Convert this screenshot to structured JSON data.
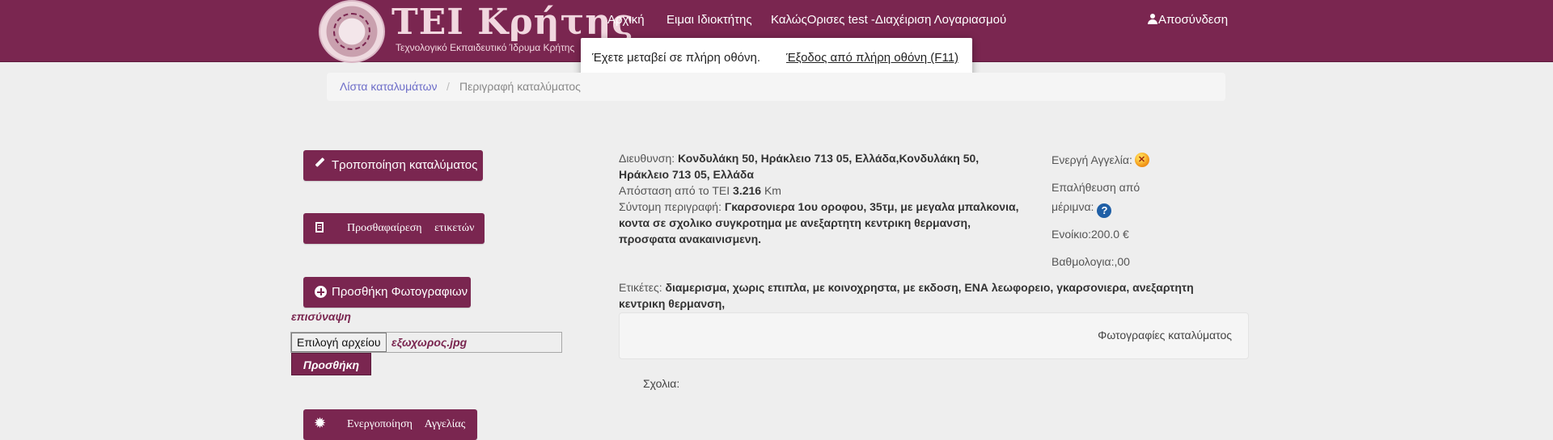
{
  "header": {
    "logo_title": "ΤΕΙ Κρήτης",
    "logo_subtitle": "Τεχνολογικό Εκπαιδευτικό Ίδρυμα Κρήτης",
    "nav": {
      "home": "Αρχική",
      "owner": "Ειμαι Ιδιοκτήτης",
      "account": "ΚαλώςΟρισες test -Διαχέιριση Λογαριασμού",
      "logout": "Αποσύνδεση"
    },
    "brand_color": "#7a2650"
  },
  "fullscreen_toast": {
    "message": "Έχετε μεταβεί σε πλήρη οθόνη.",
    "exit_link": "Έξοδος από πλήρη οθόνη (F11)"
  },
  "breadcrumb": {
    "list": "Λίστα καταλυμάτων",
    "separator": "/",
    "current": "Περιγραφή καταλύματος"
  },
  "actions": {
    "edit": "Τροποποίηση καταλύματος",
    "tags": "Προσθαφαίρεση ετικετών",
    "add_photos": "Προσθήκη Φωτογραφιων",
    "attach_label": "επισύναψη",
    "choose_file": "Επιλογή αρχείου",
    "file_name": "εξωχωρος.jpg",
    "add_button": "Προσθήκη",
    "activate": "Ενεργοποίηση Αγγελίας"
  },
  "listing": {
    "address_label": "Διευθυνση:",
    "address_line1": "Κονδυλάκη 50, Ηράκλειο 713 05, Ελλάδα,Κονδυλάκη 50,",
    "address_line2": "Ηράκλειο 713 05, Ελλάδα",
    "distance_label": "Απόσταση από το ΤΕΙ",
    "distance_value": "3.216",
    "distance_unit": "Km",
    "desc_label": "Σύντομη περιγραφή:",
    "desc_line1": "Γκαρσονιερα 1ου οροφου, 35τμ, με μεγαλα μπαλκονια,",
    "desc_line2": "κοντα σε σχολικο συγκροτημα με ανεξαρτητη κεντρικη θερμανση,",
    "desc_line3": "προσφατα ανακαινισμενη.",
    "tags_label": "Ετικέτες:",
    "tags_line1": "διαμερισμα, χωρις επιπλα, με κοινοχρηστα, με εκδοση, ΕΝΑ λεωφορειο, γκαρσονιερα, ανεξαρτητη",
    "tags_line2": "κεντρικη θερμανση,",
    "photos_title": "Φωτογραφίες καταλύματος",
    "comments_label": "Σχολια:"
  },
  "status": {
    "active_label": "Ενεργή Αγγελία:",
    "verify_line1": "Επαλήθευση από",
    "verify_line2": "μέριμνα:",
    "rent": "Ενοίκιο:200.0 €",
    "rating": "Βαθμολογια:,00"
  }
}
